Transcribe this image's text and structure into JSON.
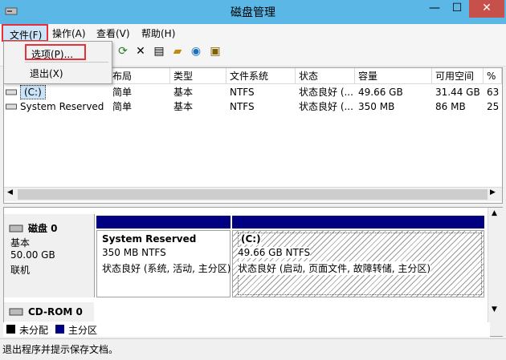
{
  "window": {
    "title": "磁盘管理",
    "min_glyph": "—",
    "max_glyph": "☐",
    "close_glyph": "✕"
  },
  "menubar": {
    "file": "文件(F)",
    "action": "操作(A)",
    "view": "查看(V)",
    "help": "帮助(H)"
  },
  "file_menu": {
    "options": "选项(P)...",
    "exit": "退出(X)"
  },
  "toolbar": {
    "icons": [
      "refresh-icon",
      "delete-icon",
      "properties-icon",
      "open-folder-icon",
      "search-icon",
      "help-icon"
    ]
  },
  "volume_table": {
    "columns": [
      "布局",
      "类型",
      "文件系统",
      "状态",
      "容量",
      "可用空间",
      "%"
    ],
    "rows": [
      {
        "name": "(C:)",
        "layout": "简单",
        "type": "基本",
        "fs": "NTFS",
        "status": "状态良好 (...",
        "capacity": "49.66 GB",
        "free": "31.44 GB",
        "pct": "63"
      },
      {
        "name": "System Reserved",
        "layout": "简单",
        "type": "基本",
        "fs": "NTFS",
        "status": "状态良好 (...",
        "capacity": "350 MB",
        "free": "86 MB",
        "pct": "25"
      }
    ]
  },
  "disk0": {
    "name": "磁盘 0",
    "type": "基本",
    "size": "50.00 GB",
    "state": "联机",
    "partitions": [
      {
        "name": "System Reserved",
        "size": "350 MB NTFS",
        "status": "状态良好 (系统, 活动, 主分区)"
      },
      {
        "name": "(C:)",
        "size": "49.66 GB NTFS",
        "status": "状态良好 (启动, 页面文件, 故障转储, 主分区)"
      }
    ]
  },
  "cdrom": {
    "name": "CD-ROM 0"
  },
  "legend": {
    "unallocated": "未分配",
    "primary": "主分区"
  },
  "status_text": "退出程序并提示保存文档。",
  "colors": {
    "titlebar": "#5bb8e6",
    "partition_header": "#000080",
    "highlight": "#e8303a"
  }
}
